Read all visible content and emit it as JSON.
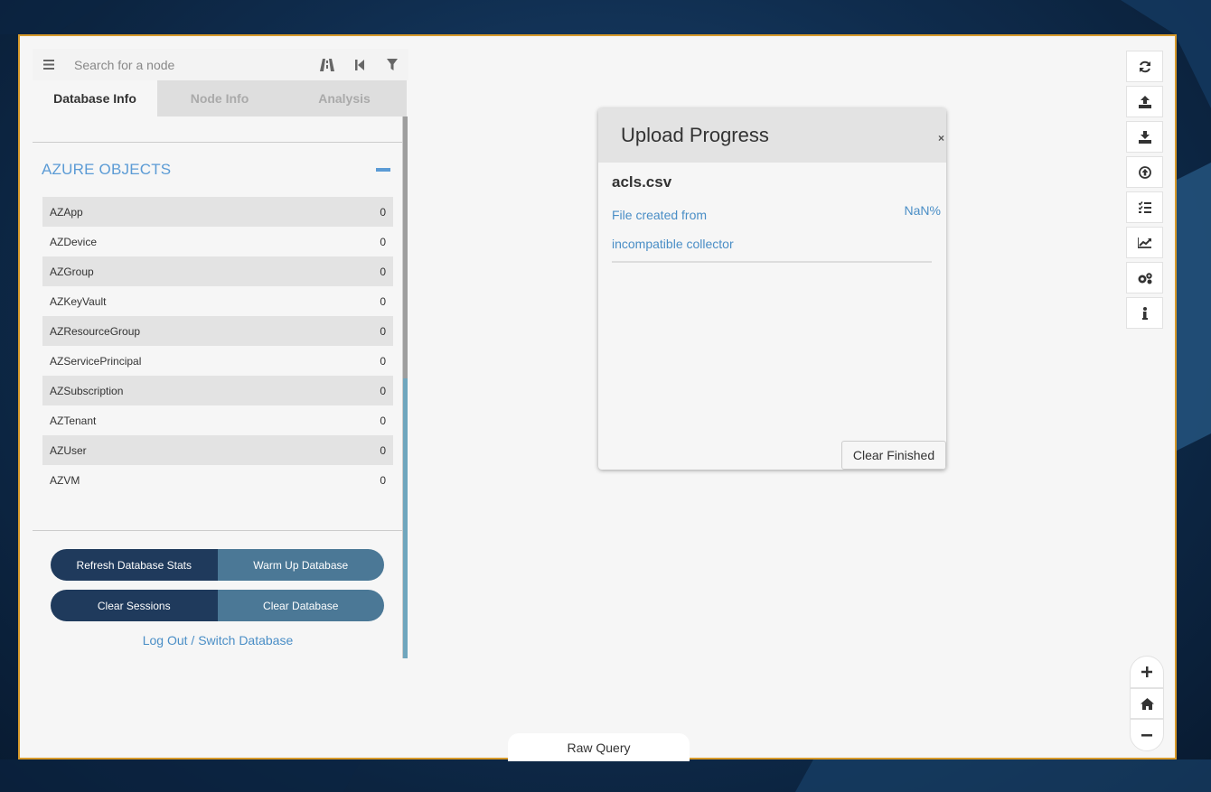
{
  "search": {
    "placeholder": "Search for a node"
  },
  "tabs": [
    {
      "label": "Database Info"
    },
    {
      "label": "Node Info"
    },
    {
      "label": "Analysis"
    }
  ],
  "azure": {
    "title": "AZURE OBJECTS",
    "rows": [
      {
        "label": "AZApp",
        "count": "0"
      },
      {
        "label": "AZDevice",
        "count": "0"
      },
      {
        "label": "AZGroup",
        "count": "0"
      },
      {
        "label": "AZKeyVault",
        "count": "0"
      },
      {
        "label": "AZResourceGroup",
        "count": "0"
      },
      {
        "label": "AZServicePrincipal",
        "count": "0"
      },
      {
        "label": "AZSubscription",
        "count": "0"
      },
      {
        "label": "AZTenant",
        "count": "0"
      },
      {
        "label": "AZUser",
        "count": "0"
      },
      {
        "label": "AZVM",
        "count": "0"
      }
    ]
  },
  "actions": {
    "refresh": "Refresh Database Stats",
    "warmup": "Warm Up Database",
    "clear_sessions": "Clear Sessions",
    "clear_database": "Clear Database",
    "logout": "Log Out / Switch Database"
  },
  "modal": {
    "title": "Upload Progress",
    "close": "×",
    "file": "acls.csv",
    "status": "File created from incompatible collector",
    "percent": "NaN%",
    "clear_finished": "Clear Finished"
  },
  "raw_query": "Raw Query",
  "toolbar_icons": [
    "refresh-icon",
    "upload-icon",
    "download-icon",
    "upload-circle-icon",
    "queries-icon",
    "chart-icon",
    "settings-icon",
    "info-icon"
  ],
  "colors": {
    "accent": "#5b9bd5",
    "dark_button": "#1f3a5c",
    "light_button": "#4b7896",
    "border": "#d79a2b"
  }
}
